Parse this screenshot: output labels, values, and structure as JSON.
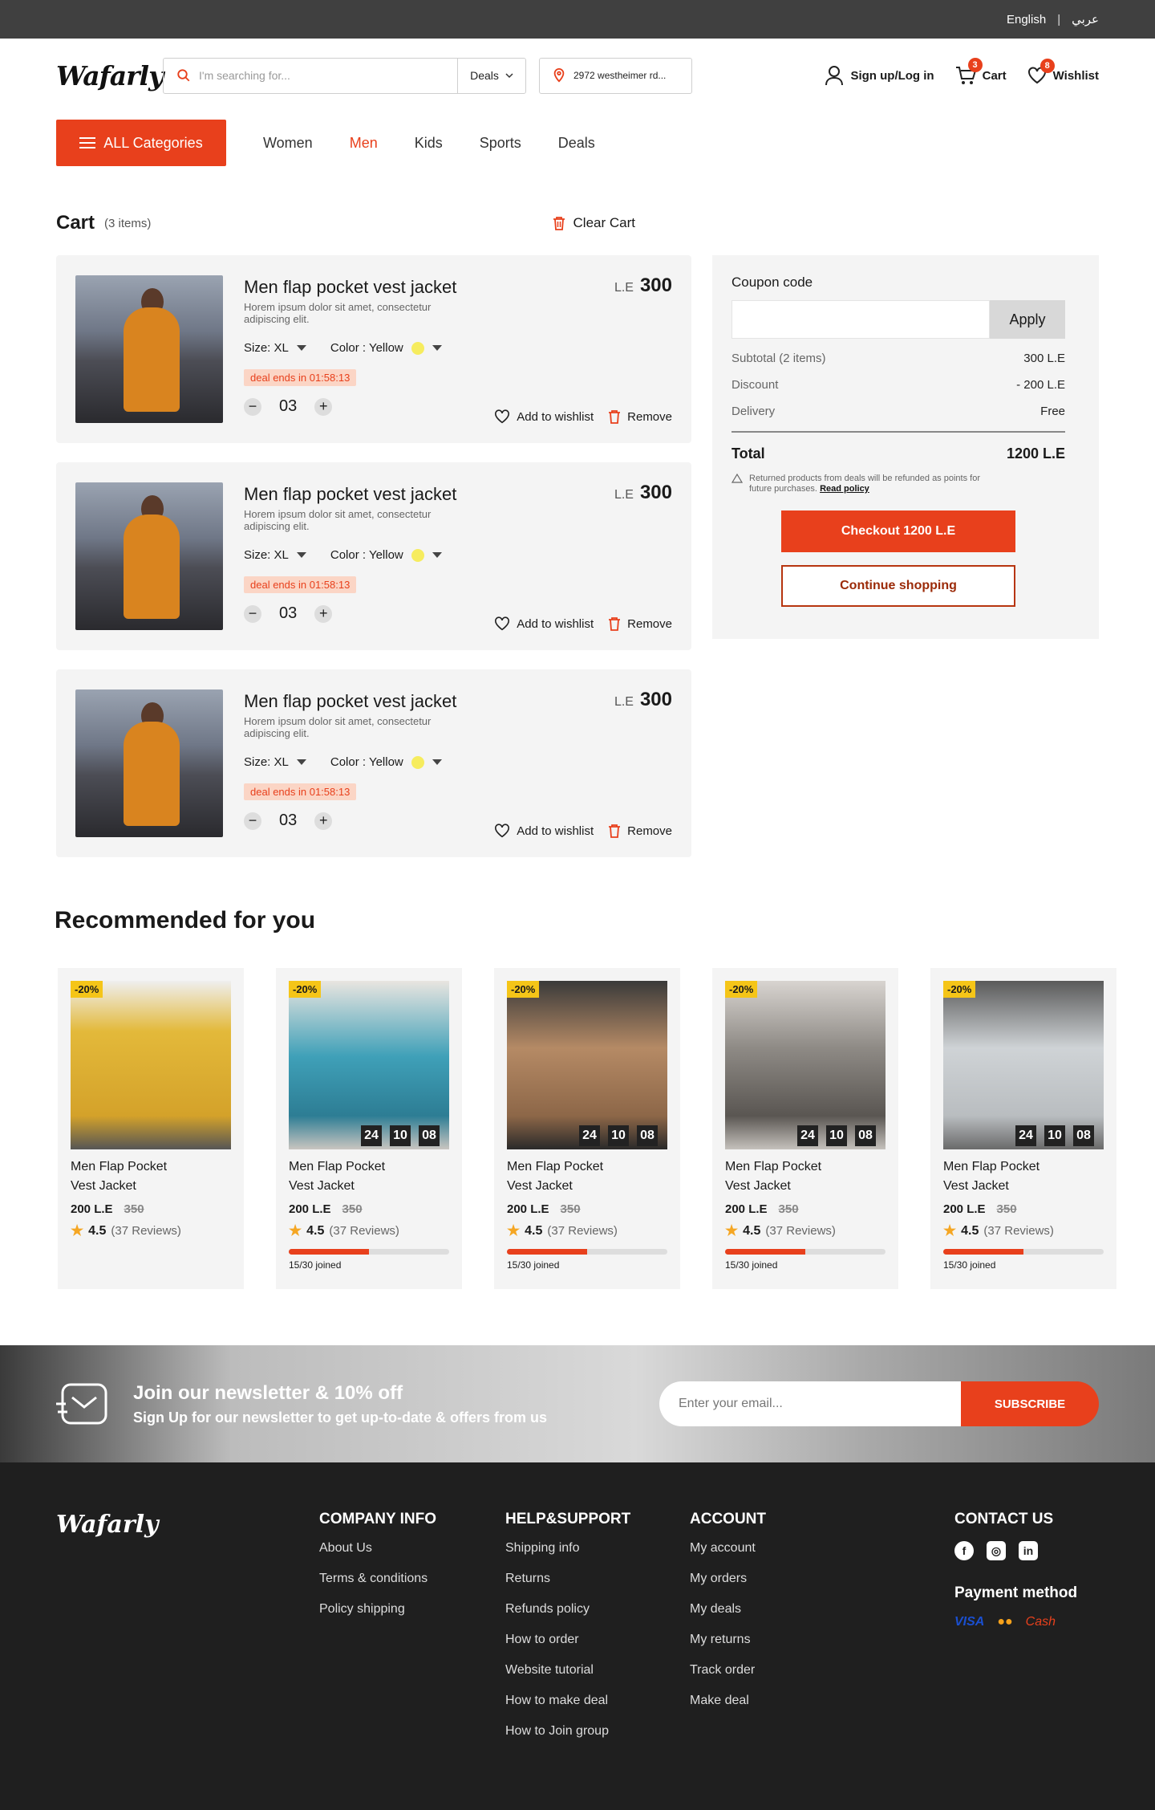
{
  "topbar": {
    "english": "English",
    "arabic": "عربي",
    "separator": "|"
  },
  "header": {
    "logo": "Wafarly",
    "search_placeholder": "I'm searching for...",
    "search_category": "Deals",
    "location": "2972 westheimer rd...",
    "signin": "Sign up/Log in",
    "cart_label": "Cart",
    "cart_count": "3",
    "wishlist_label": "Wishlist",
    "wishlist_count": "8"
  },
  "nav": {
    "all_categories": "ALL Categories",
    "links": [
      "Women",
      "Men",
      "Kids",
      "Sports",
      "Deals"
    ]
  },
  "cart": {
    "title": "Cart",
    "count": "(3 items)",
    "clear": "Clear Cart",
    "items": [
      {
        "title": "Men flap pocket vest jacket",
        "desc": "Horem ipsum dolor sit amet, consectetur adipiscing elit.",
        "currency": "L.E",
        "price": "300",
        "size": "Size: XL",
        "color": "Color : Yellow",
        "deal": "deal ends in 01:58:13",
        "qty": "03",
        "wishlist": "Add to wishlist",
        "remove": "Remove"
      },
      {
        "title": "Men flap pocket vest jacket",
        "desc": "Horem ipsum dolor sit amet, consectetur adipiscing elit.",
        "currency": "L.E",
        "price": "300",
        "size": "Size: XL",
        "color": "Color : Yellow",
        "deal": "deal ends in 01:58:13",
        "qty": "03",
        "wishlist": "Add to wishlist",
        "remove": "Remove"
      },
      {
        "title": "Men flap pocket vest jacket",
        "desc": "Horem ipsum dolor sit amet, consectetur adipiscing elit.",
        "currency": "L.E",
        "price": "300",
        "size": "Size: XL",
        "color": "Color : Yellow",
        "deal": "deal ends in 01:58:13",
        "qty": "03",
        "wishlist": "Add to wishlist",
        "remove": "Remove"
      }
    ]
  },
  "summary": {
    "coupon_label": "Coupon code",
    "apply": "Apply",
    "subtotal_label": "Subtotal (2 items)",
    "subtotal": "300 L.E",
    "discount_label": "Discount",
    "discount": "- 200 L.E",
    "delivery_label": "Delivery",
    "delivery": "Free",
    "total_label": "Total",
    "total": "1200 L.E",
    "note": "Returned products from deals will be refunded as points for future purchases.",
    "read_policy": "Read policy",
    "checkout": "Checkout 1200 L.E",
    "continue": "Continue shopping"
  },
  "recommended": {
    "title": "Recommended for you",
    "products": [
      {
        "discount": "-20%",
        "name": "Men Flap Pocket Vest Jacket",
        "price": "200 L.E",
        "old_price": "350",
        "rating": "4.5",
        "reviews": "(37 Reviews)",
        "timer": [],
        "progress": null,
        "joined": ""
      },
      {
        "discount": "-20%",
        "name": "Men Flap Pocket Vest Jacket",
        "price": "200 L.E",
        "old_price": "350",
        "rating": "4.5",
        "reviews": "(37 Reviews)",
        "timer": [
          "24",
          "10",
          "08"
        ],
        "progress": 0.5,
        "joined": "15/30 joined"
      },
      {
        "discount": "-20%",
        "name": "Men Flap Pocket Vest Jacket",
        "price": "200 L.E",
        "old_price": "350",
        "rating": "4.5",
        "reviews": "(37 Reviews)",
        "timer": [
          "24",
          "10",
          "08"
        ],
        "progress": 0.5,
        "joined": "15/30 joined"
      },
      {
        "discount": "-20%",
        "name": "Men Flap Pocket Vest Jacket",
        "price": "200 L.E",
        "old_price": "350",
        "rating": "4.5",
        "reviews": "(37 Reviews)",
        "timer": [
          "24",
          "10",
          "08"
        ],
        "progress": 0.5,
        "joined": "15/30 joined"
      },
      {
        "discount": "-20%",
        "name": "Men Flap Pocket Vest Jacket",
        "price": "200 L.E",
        "old_price": "350",
        "rating": "4.5",
        "reviews": "(37 Reviews)",
        "timer": [
          "24",
          "10",
          "08"
        ],
        "progress": 0.5,
        "joined": "15/30 joined"
      }
    ]
  },
  "newsletter": {
    "title": "Join our newsletter & 10% off",
    "subtitle": "Sign Up for our newsletter to get up-to-date & offers from us",
    "placeholder": "Enter your email...",
    "button": "SUBSCRIBE"
  },
  "footer": {
    "logo": "Wafarly",
    "company": {
      "title": "COMPANY INFO",
      "links": [
        "About Us",
        "Terms & conditions",
        "Policy shipping"
      ]
    },
    "help": {
      "title": "HELP&SUPPORT",
      "links": [
        "Shipping info",
        "Returns",
        "Refunds policy",
        "How to order",
        "Website tutorial",
        "How to make deal",
        "How to Join group"
      ]
    },
    "account": {
      "title": "ACCOUNT",
      "links": [
        "My account",
        "My orders",
        "My deals",
        "My returns",
        "Track order",
        "Make deal"
      ]
    },
    "contact": {
      "title": "CONTACT  US",
      "payment_title": "Payment method",
      "visa": "VISA",
      "cash": "Cash"
    }
  },
  "colors": {
    "accent": "#e8401c",
    "deal_bg": "#fbd5c5",
    "badge_yellow": "#f5c518"
  }
}
